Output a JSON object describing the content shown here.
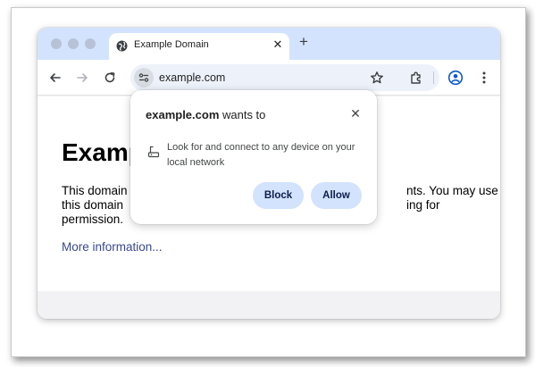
{
  "tab": {
    "title": "Example Domain"
  },
  "omnibox": {
    "url": "example.com"
  },
  "page": {
    "heading_visible": "Examp",
    "paragraph_left_lines": [
      "This domain",
      "this domain",
      "permission."
    ],
    "paragraph_right_lines": [
      "nts. You may use",
      "ing for"
    ],
    "link": "More information..."
  },
  "permission_popup": {
    "site": "example.com",
    "title_suffix": " wants to",
    "permission_text": "Look for and connect to any device on your local network",
    "block_label": "Block",
    "allow_label": "Allow"
  },
  "colors": {
    "tabstrip": "#d3e3fd",
    "omnibox": "#edf2fa",
    "button_bg": "#d3e3fd",
    "link": "#38488f"
  },
  "icons": [
    "globe-icon",
    "close-icon",
    "plus-icon",
    "back-icon",
    "forward-icon",
    "reload-icon",
    "tune-icon",
    "star-icon",
    "extensions-icon",
    "profile-icon",
    "more-vert-icon",
    "local-network-icon"
  ]
}
